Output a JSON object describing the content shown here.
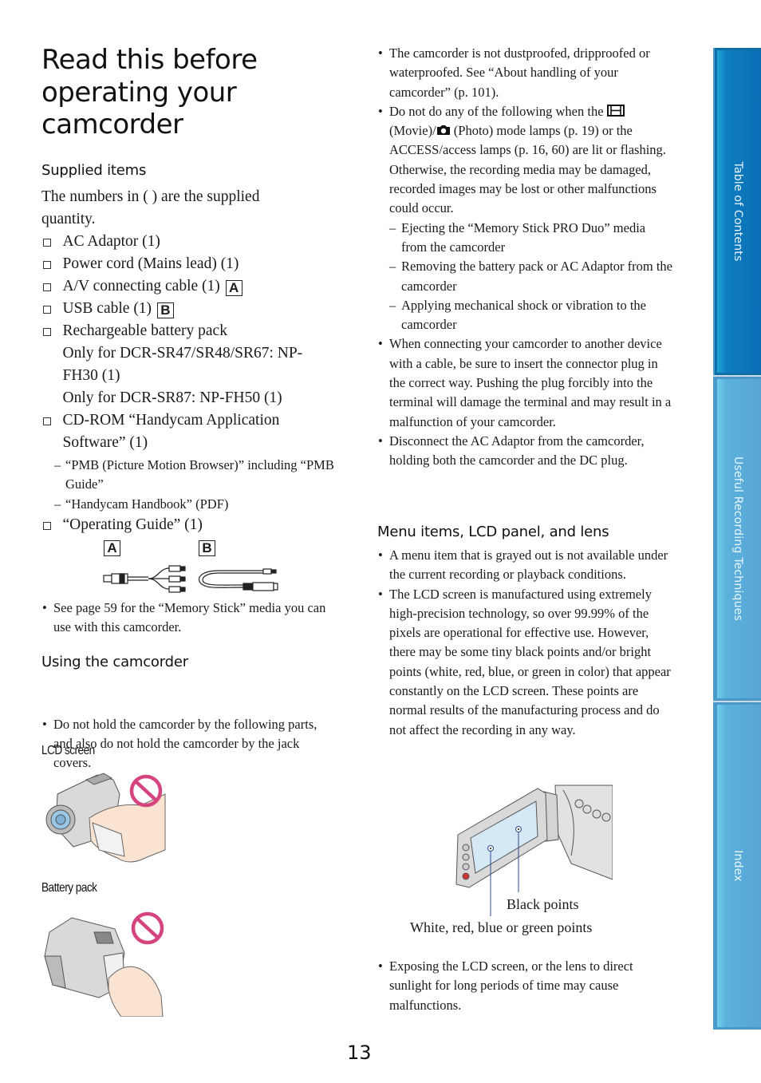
{
  "page": {
    "title": "Read this before operating your camcorder",
    "page_number": "13"
  },
  "sidebar": {
    "tabs": [
      {
        "label": "Table of Contents",
        "icon": "none"
      },
      {
        "label": "Useful Recording Techniques",
        "icon": "none"
      },
      {
        "label": "Index",
        "icon": "none"
      }
    ],
    "colors": {
      "active": "#0a6db4",
      "inactive": "#5aa4d6"
    }
  },
  "supplied_items": {
    "heading": "Supplied items",
    "intro": "The numbers in ( ) are the supplied quantity.",
    "items": [
      {
        "text": "AC Adaptor (1)",
        "label": ""
      },
      {
        "text": "Power cord (Mains lead) (1)",
        "label": ""
      },
      {
        "text": "A/V connecting cable (1)",
        "label": "A"
      },
      {
        "text": "USB cable (1)",
        "label": "B"
      },
      {
        "text": "Rechargeable battery pack",
        "label": ""
      }
    ],
    "battery_notes": [
      "Only for DCR-SR47/SR48/SR67: NP-FH30 (1)",
      "Only for DCR-SR87: NP-FH50 (1)"
    ],
    "cdrom": "CD-ROM “Handycam Application Software” (1)",
    "cdrom_subitems": [
      "“PMB (Picture Motion Browser)” including “PMB Guide”",
      "“Handycam Handbook” (PDF)"
    ],
    "guide": "“Operating Guide” (1)",
    "figure_labels": [
      "A",
      "B"
    ],
    "note": "See page 59 for the “Memory Stick” media you can use with this camcorder."
  },
  "using": {
    "heading": "Using the camcorder",
    "bullet": "Do not hold the camcorder by the following parts, and also do not hold the camcorder by the jack covers.",
    "captions": [
      "LCD screen",
      "Battery pack"
    ]
  },
  "right": {
    "bullets_top": [
      "The camcorder is not dustproofed, dripproofed or waterproofed. See “About handling of your camcorder” (p. 101)."
    ],
    "lamps_bullet": {
      "part1": "Do not do any of the following when the",
      "movie_icon": "movie-film-icon",
      "part2": "(Movie)/",
      "photo_icon": "camera-icon",
      "part3": "(Photo) mode lamps (p. 19) or the ACCESS/access lamps (p. 16, 60) are lit or flashing. Otherwise, the recording media may be damaged, recorded images may be lost or other malfunctions could occur."
    },
    "dashes": [
      "Ejecting the “Memory Stick PRO Duo” media from the camcorder",
      "Removing the battery pack or AC Adaptor from the camcorder",
      "Applying mechanical shock or vibration to the camcorder"
    ],
    "bullets_mid": [
      "When connecting your camcorder to another device with a cable, be sure to insert the connector plug in the correct way. Pushing the plug forcibly into the terminal will damage the terminal and may result in a malfunction of your camcorder.",
      "Disconnect the AC Adaptor from the camcorder, holding both the camcorder and the DC plug."
    ],
    "menu_heading": "Menu items, LCD panel, and lens",
    "menu_bullets": [
      "A menu item that is grayed out is not available under the current recording or playback conditions.",
      "The LCD screen is manufactured using extremely high-precision technology, so over 99.99% of the pixels are operational for effective use. However, there may be some tiny black points and/or bright points (white, red, blue, or green in color) that appear constantly on the LCD screen. These points are normal results of the manufacturing process and do not affect the recording in any way."
    ],
    "lcd_labels": {
      "black": "Black points",
      "bright": "White, red, blue or green points"
    },
    "last_bullet": "Exposing the LCD screen, or the lens to direct sunlight for long periods of time may cause malfunctions."
  },
  "symbols": {
    "dash": "–",
    "bullet": "•"
  }
}
